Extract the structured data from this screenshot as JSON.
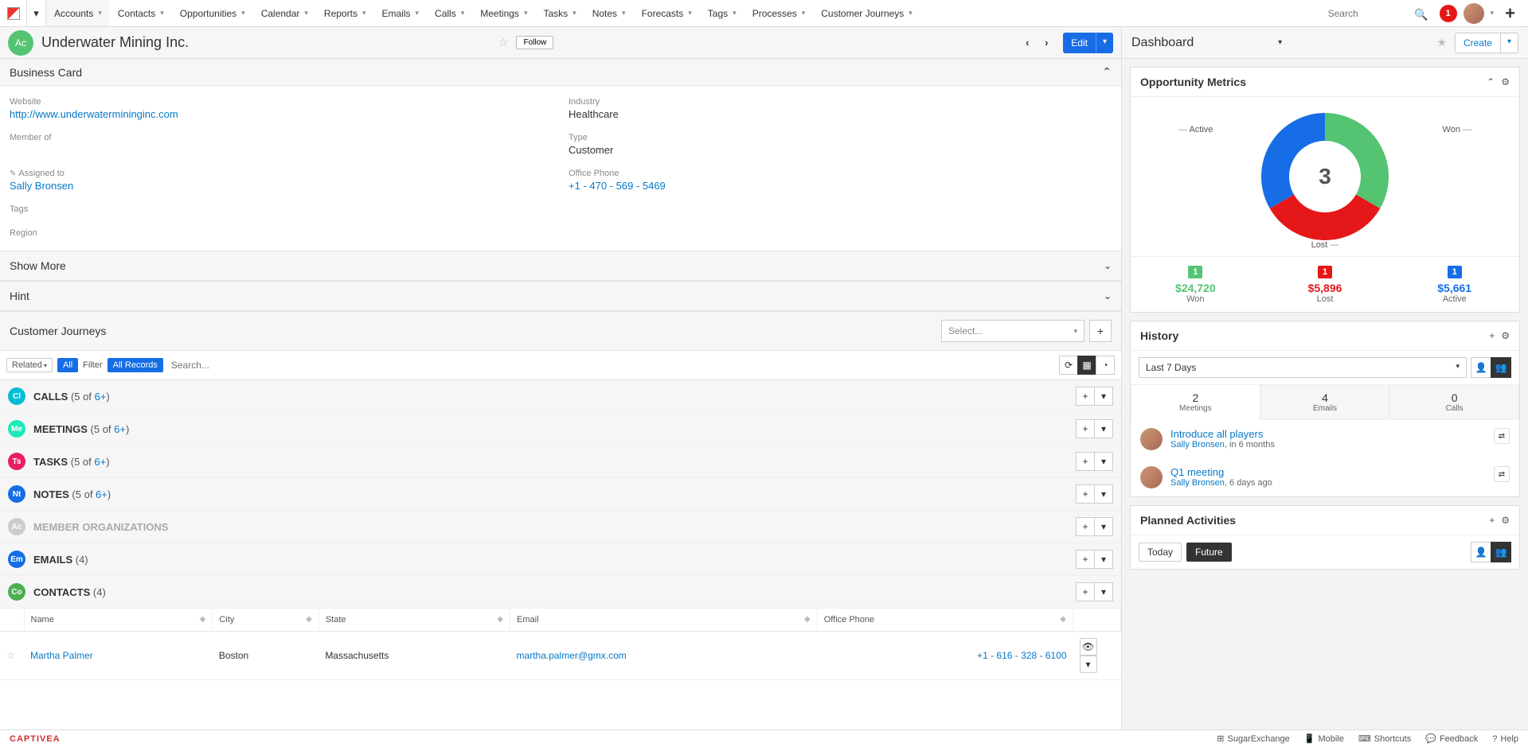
{
  "nav": {
    "items": [
      "Accounts",
      "Contacts",
      "Opportunities",
      "Calendar",
      "Reports",
      "Emails",
      "Calls",
      "Meetings",
      "Tasks",
      "Notes",
      "Forecasts",
      "Tags",
      "Processes",
      "Customer Journeys"
    ],
    "active": "Accounts",
    "search_placeholder": "Search",
    "notification_count": "1"
  },
  "record": {
    "avatar": "Ac",
    "name": "Underwater Mining Inc.",
    "follow": "Follow",
    "edit": "Edit"
  },
  "business_card": {
    "title": "Business Card",
    "website_label": "Website",
    "website": "http://www.underwatermininginc.com",
    "member_of_label": "Member of",
    "member_of": "",
    "assigned_label": "Assigned to",
    "assigned": "Sally Bronsen",
    "tags_label": "Tags",
    "region_label": "Region",
    "industry_label": "Industry",
    "industry": "Healthcare",
    "type_label": "Type",
    "type": "Customer",
    "phone_label": "Office Phone",
    "phone": "+1 - 470 - 569 - 5469"
  },
  "sections": {
    "show_more": "Show More",
    "hint": "Hint",
    "cj": "Customer Journeys",
    "cj_select": "Select..."
  },
  "filter": {
    "related": "Related",
    "all": "All",
    "filter_lbl": "Filter",
    "all_records": "All Records",
    "search": "Search..."
  },
  "related": [
    {
      "icon": "Cl",
      "color": "#00bcd4",
      "name": "CALLS",
      "count": "(5 of ",
      "link": "6+",
      "end": ")"
    },
    {
      "icon": "Me",
      "color": "#1de9b6",
      "name": "MEETINGS",
      "count": "(5 of ",
      "link": "6+",
      "end": ")"
    },
    {
      "icon": "Ts",
      "color": "#e91e63",
      "name": "TASKS",
      "count": "(5 of ",
      "link": "6+",
      "end": ")"
    },
    {
      "icon": "Nt",
      "color": "#176de5",
      "name": "NOTES",
      "count": "(5 of ",
      "link": "6+",
      "end": ")"
    },
    {
      "icon": "Ac",
      "color": "#ccc",
      "name": "MEMBER ORGANIZATIONS",
      "count": "",
      "link": "",
      "end": "",
      "muted": true
    },
    {
      "icon": "Em",
      "color": "#176de5",
      "name": "EMAILS",
      "count": "(4)",
      "link": "",
      "end": ""
    },
    {
      "icon": "Co",
      "color": "#4caf50",
      "name": "CONTACTS",
      "count": "(4)",
      "link": "",
      "end": "",
      "expanded": true
    }
  ],
  "contacts": {
    "columns": [
      "Name",
      "City",
      "State",
      "Email",
      "Office Phone"
    ],
    "rows": [
      {
        "name": "Martha Palmer",
        "city": "Boston",
        "state": "Massachusetts",
        "email": "martha.palmer@gmx.com",
        "phone": "+1 - 616 - 328 - 6100"
      }
    ]
  },
  "dashboard": {
    "title": "Dashboard",
    "create": "Create"
  },
  "opp_metrics": {
    "title": "Opportunity Metrics",
    "center": "3",
    "labels": {
      "active": "Active",
      "won": "Won",
      "lost": "Lost"
    },
    "won": {
      "count": "1",
      "amount": "$24,720",
      "label": "Won",
      "color": "#54c473"
    },
    "lost": {
      "count": "1",
      "amount": "$5,896",
      "label": "Lost",
      "color": "#e61718"
    },
    "active": {
      "count": "1",
      "amount": "$5,661",
      "label": "Active",
      "color": "#176de5"
    }
  },
  "history": {
    "title": "History",
    "range": "Last 7 Days",
    "tabs": [
      {
        "n": "2",
        "l": "Meetings"
      },
      {
        "n": "4",
        "l": "Emails"
      },
      {
        "n": "0",
        "l": "Calls"
      }
    ],
    "items": [
      {
        "title": "Introduce all players",
        "user": "Sally Bronsen",
        "when": ", in 6 months"
      },
      {
        "title": "Q1 meeting",
        "user": "Sally Bronsen",
        "when": ", 6 days ago"
      }
    ]
  },
  "planned": {
    "title": "Planned Activities",
    "today": "Today",
    "future": "Future"
  },
  "footer": {
    "brand": "CAPTIVEA",
    "links": [
      "SugarExchange",
      "Mobile",
      "Shortcuts",
      "Feedback",
      "Help"
    ]
  },
  "chart_data": {
    "type": "pie",
    "title": "Opportunity Metrics",
    "series": [
      {
        "name": "Won",
        "value": 1,
        "amount": 24720,
        "color": "#54c473"
      },
      {
        "name": "Lost",
        "value": 1,
        "amount": 5896,
        "color": "#e61718"
      },
      {
        "name": "Active",
        "value": 1,
        "amount": 5661,
        "color": "#176de5"
      }
    ],
    "total": 3
  }
}
